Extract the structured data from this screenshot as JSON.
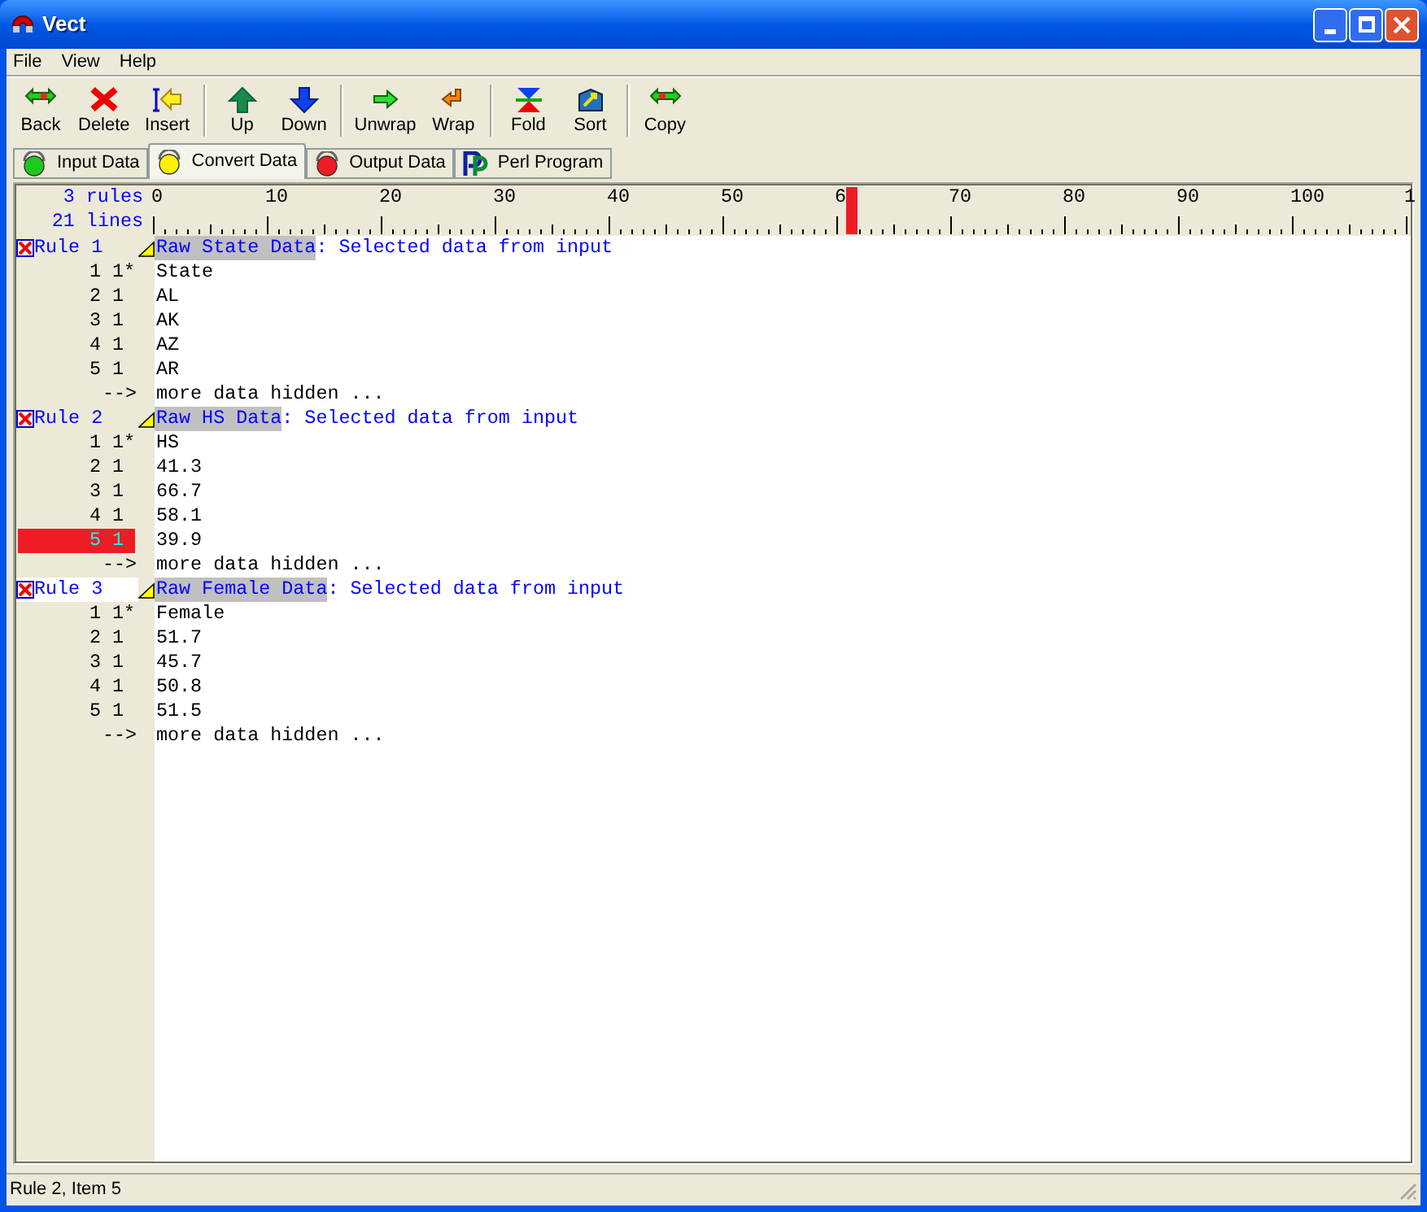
{
  "window": {
    "title": "Vect"
  },
  "menu": [
    "File",
    "View",
    "Help"
  ],
  "toolbar": [
    [
      {
        "label": "Back",
        "kind": "back"
      },
      {
        "label": "Delete",
        "kind": "delete"
      },
      {
        "label": "Insert",
        "kind": "insert"
      }
    ],
    [
      {
        "label": "Up",
        "kind": "up"
      },
      {
        "label": "Down",
        "kind": "down"
      }
    ],
    [
      {
        "label": "Unwrap",
        "kind": "unwrap"
      },
      {
        "label": "Wrap",
        "kind": "wrap"
      }
    ],
    [
      {
        "label": "Fold",
        "kind": "fold"
      },
      {
        "label": "Sort",
        "kind": "sort"
      }
    ],
    [
      {
        "label": "Copy",
        "kind": "copy"
      }
    ]
  ],
  "tabs": [
    {
      "label": "Input Data",
      "kind": "green",
      "selected": false
    },
    {
      "label": "Convert Data",
      "kind": "yellow",
      "selected": true
    },
    {
      "label": "Output Data",
      "kind": "red",
      "selected": false
    },
    {
      "label": "Perl Program",
      "kind": "perl",
      "selected": false
    }
  ],
  "summary": {
    "rules": "3 rules",
    "lines": "21 lines"
  },
  "ruler": {
    "labels": [
      "0",
      "10",
      "20",
      "30",
      "40",
      "50",
      "6",
      "70",
      "80",
      "90",
      "100",
      "1"
    ],
    "cursor": {
      "level": 0.5545
    }
  },
  "rules": [
    {
      "label": "Rule 1",
      "highlighted": false,
      "title": "Raw State Data",
      "description": ": Selected data from input",
      "items": [
        {
          "index": "1",
          "count": "1*",
          "value": "State",
          "selected": false
        },
        {
          "index": "2",
          "count": "1",
          "value": "AL",
          "selected": false
        },
        {
          "index": "3",
          "count": "1",
          "value": "AK",
          "selected": false
        },
        {
          "index": "4",
          "count": "1",
          "value": "AZ",
          "selected": false
        },
        {
          "index": "5",
          "count": "1",
          "value": "AR",
          "selected": false
        }
      ],
      "more": {
        "arrow": "-->",
        "text": "more data hidden ..."
      }
    },
    {
      "label": "Rule 2",
      "highlighted": false,
      "title": "Raw HS Data",
      "description": ": Selected data from input",
      "items": [
        {
          "index": "1",
          "count": "1*",
          "value": "HS",
          "selected": false
        },
        {
          "index": "2",
          "count": "1",
          "value": "41.3",
          "selected": false
        },
        {
          "index": "3",
          "count": "1",
          "value": "66.7",
          "selected": false
        },
        {
          "index": "4",
          "count": "1",
          "value": "58.1",
          "selected": false
        },
        {
          "index": "5",
          "count": "1",
          "value": "39.9",
          "selected": true
        }
      ],
      "more": {
        "arrow": "-->",
        "text": "more data hidden ..."
      }
    },
    {
      "label": "Rule 3",
      "highlighted": true,
      "title": "Raw Female Data",
      "description": ": Selected data from input",
      "items": [
        {
          "index": "1",
          "count": "1*",
          "value": "Female",
          "selected": false
        },
        {
          "index": "2",
          "count": "1",
          "value": "51.7",
          "selected": false
        },
        {
          "index": "3",
          "count": "1",
          "value": "45.7",
          "selected": false
        },
        {
          "index": "4",
          "count": "1",
          "value": "50.8",
          "selected": false
        },
        {
          "index": "5",
          "count": "1",
          "value": "51.5",
          "selected": false
        }
      ],
      "more": {
        "arrow": "-->",
        "text": "more data hidden ..."
      }
    }
  ],
  "status_bar": "Rule 2, Item 5"
}
